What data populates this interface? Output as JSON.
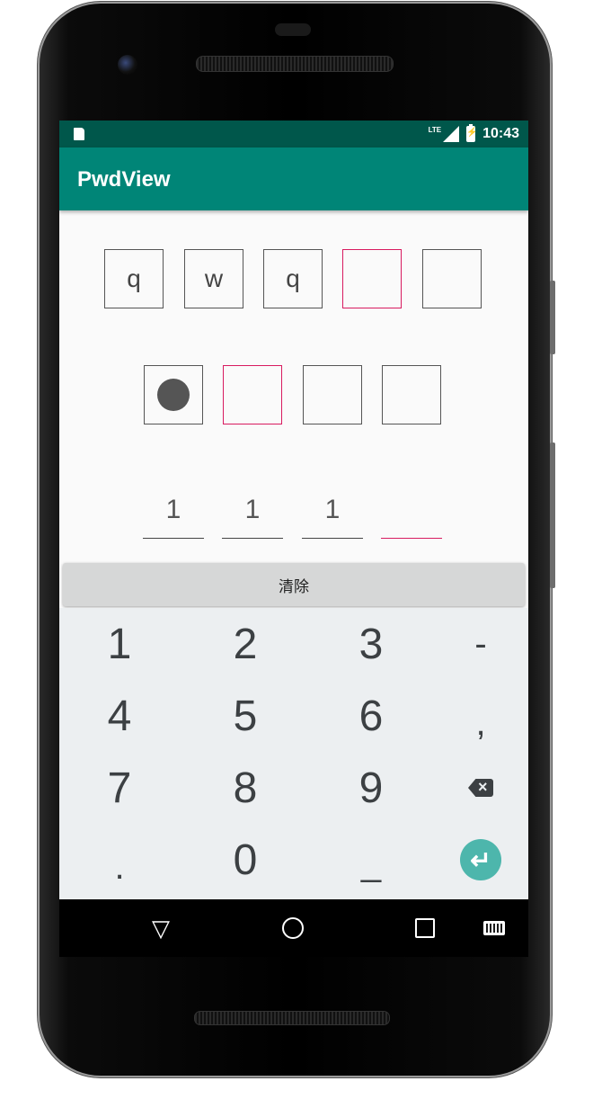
{
  "status_bar": {
    "network": "LTE",
    "time": "10:43"
  },
  "app_bar": {
    "title": "PwdView"
  },
  "pwd_rect": {
    "chars": [
      "q",
      "w",
      "q",
      "",
      ""
    ],
    "active_index": 3
  },
  "pwd_dot": {
    "filled": [
      true,
      false,
      false,
      false
    ],
    "active_index": 1
  },
  "pwd_underline": {
    "chars": [
      "1",
      "1",
      "1",
      ""
    ],
    "active_index": 3
  },
  "clear_button": {
    "label": "清除"
  },
  "keyboard": {
    "row1": [
      "1",
      "2",
      "3",
      "-"
    ],
    "row2": [
      "4",
      "5",
      "6",
      ","
    ],
    "row3": [
      "7",
      "8",
      "9"
    ],
    "row4": [
      ".",
      "0",
      "_"
    ]
  },
  "colors": {
    "primary": "#008577",
    "primary_dark": "#00574b",
    "accent": "#d81b60",
    "enter_key": "#4db6ac"
  },
  "icons": [
    "sd-card-icon",
    "lte-signal-icon",
    "battery-charging-icon",
    "backspace-icon",
    "enter-icon",
    "back-icon",
    "home-icon",
    "recents-icon",
    "keyboard-icon"
  ]
}
